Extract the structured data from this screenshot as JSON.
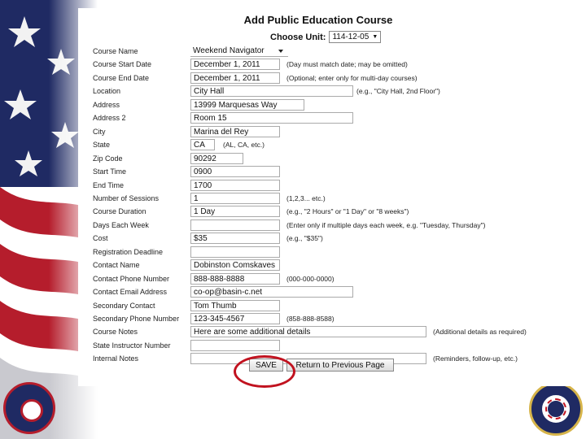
{
  "page": {
    "title": "Add Public Education Course",
    "unit_label": "Choose Unit:",
    "unit_value": "114-12-05"
  },
  "form": [
    {
      "label": "Course Name",
      "value": "Weekend Navigator",
      "hint": "",
      "dropdown": true
    },
    {
      "label": "Course Start Date",
      "value": "December 1, 2011",
      "hint": "(Day must match date; may be omitted)"
    },
    {
      "label": "Course End Date",
      "value": "December 1, 2011",
      "hint": "(Optional; enter only for multi-day courses)"
    },
    {
      "label": "Location",
      "value": "City Hall",
      "hint": "(e.g., \"City Hall, 2nd Floor\")"
    },
    {
      "label": "Address",
      "value": "13999 Marquesas Way",
      "hint": ""
    },
    {
      "label": "Address 2",
      "value": "Room 15",
      "hint": ""
    },
    {
      "label": "City",
      "value": "Marina del Rey",
      "hint": ""
    },
    {
      "label": "State",
      "value": "CA",
      "hint": "(AL, CA, etc.)"
    },
    {
      "label": "Zip Code",
      "value": "90292",
      "hint": ""
    },
    {
      "label": "Start Time",
      "value": "0900",
      "hint": ""
    },
    {
      "label": "End Time",
      "value": "1700",
      "hint": ""
    },
    {
      "label": "Number of Sessions",
      "value": "1",
      "hint": "(1,2,3... etc.)"
    },
    {
      "label": "Course Duration",
      "value": "1 Day",
      "hint": "(e.g., \"2 Hours\" or \"1 Day\" or \"8 weeks\")"
    },
    {
      "label": "Days Each Week",
      "value": "",
      "hint": "(Enter only if multiple days each week, e.g. \"Tuesday, Thursday\")"
    },
    {
      "label": "Cost",
      "value": "$35",
      "hint": "(e.g., \"$35\")"
    },
    {
      "label": "Registration Deadline",
      "value": "",
      "hint": ""
    },
    {
      "label": "Contact Name",
      "value": "Dobinston Comskaves",
      "hint": ""
    },
    {
      "label": "Contact Phone Number",
      "value": "888-888-8888",
      "hint": "(000-000-0000)"
    },
    {
      "label": "Contact Email Address",
      "value": "co-op@basin-c.net",
      "hint": ""
    },
    {
      "label": "Secondary Contact",
      "value": "Tom Thumb",
      "hint": ""
    },
    {
      "label": "Secondary Phone Number",
      "value": "123-345-4567",
      "hint": "(858-888-8588)"
    },
    {
      "label": "Course Notes",
      "value": "Here are some additional details",
      "hint": "(Additional details as required)"
    },
    {
      "label": "State Instructor Number",
      "value": "",
      "hint": ""
    },
    {
      "label": "Internal Notes",
      "value": "",
      "hint": "(Reminders, follow-up, etc.)"
    }
  ],
  "buttons": {
    "save": "SAVE",
    "return": "Return to Previous Page"
  },
  "colors": {
    "highlight": "#c1121f",
    "flag_blue": "#1f2a63",
    "flag_red": "#b51d2c"
  }
}
